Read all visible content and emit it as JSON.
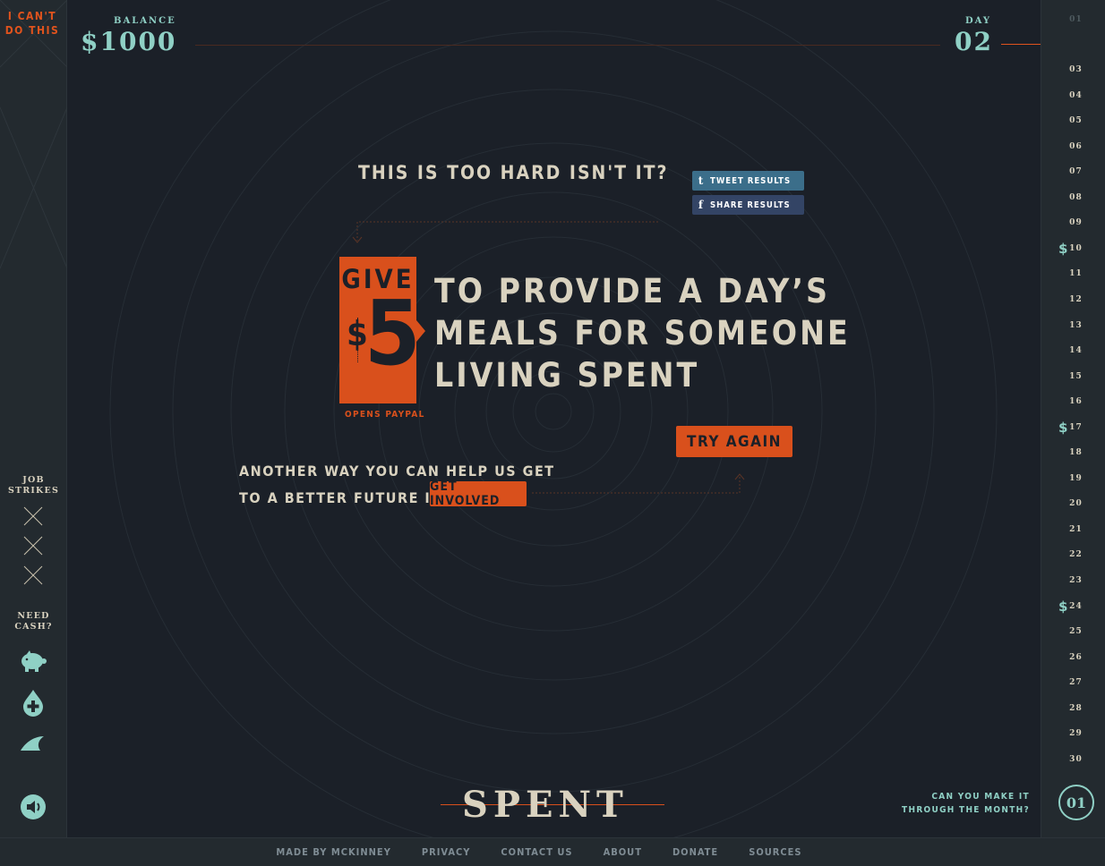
{
  "header": {
    "quit_label_line1": "I CAN'T",
    "quit_label_line2": "DO THIS",
    "balance_label": "BALANCE",
    "balance_value": "$1000",
    "day_label": "DAY",
    "day_value": "02"
  },
  "sidebar": {
    "job_strikes_line1": "JOB",
    "job_strikes_line2": "STRIKES",
    "need_cash_line1": "NEED",
    "need_cash_line2": "CASH?",
    "icons": [
      "piggy-bank-icon",
      "blood-drop-plus-icon",
      "shark-fin-icon",
      "speaker-icon"
    ]
  },
  "days": {
    "items": [
      "01",
      "03",
      "04",
      "05",
      "06",
      "07",
      "08",
      "09",
      "10",
      "11",
      "12",
      "13",
      "14",
      "15",
      "16",
      "17",
      "18",
      "19",
      "20",
      "21",
      "22",
      "23",
      "24",
      "25",
      "26",
      "27",
      "28",
      "29",
      "30"
    ],
    "paydays": [
      "10",
      "17",
      "24"
    ],
    "current": "02"
  },
  "main": {
    "headline": "THIS IS TOO HARD ISN'T IT?",
    "tweet_label": "TWEET RESULTS",
    "share_label": "SHARE RESULTS",
    "give_label": "GIVE",
    "give_currency": "$",
    "give_amount": "5",
    "opens_label": "OPENS PAYPAL",
    "pitch_line1": "TO PROVIDE A DAY’S",
    "pitch_line2": "MEALS FOR SOMEONE",
    "pitch_line3": "LIVING SPENT",
    "try_again_label": "TRY AGAIN",
    "another_line1": "ANOTHER WAY YOU CAN HELP US GET",
    "another_line2": "TO A BETTER FUTURE IS TO",
    "get_involved_label": "GET INVOLVED"
  },
  "bottom": {
    "logo": "SPENT",
    "can_you_line1": "CAN YOU MAKE IT",
    "can_you_line2": "THROUGH THE MONTH?",
    "month_badge": "01"
  },
  "footer": {
    "links": [
      "MADE BY MCKINNEY",
      "PRIVACY",
      "CONTACT US",
      "ABOUT",
      "DONATE",
      "SOURCES"
    ]
  },
  "colors": {
    "background": "#1b2028",
    "accent_orange": "#d9501c",
    "accent_teal": "#8fd0c5",
    "text_cream": "#d9d2bf"
  }
}
